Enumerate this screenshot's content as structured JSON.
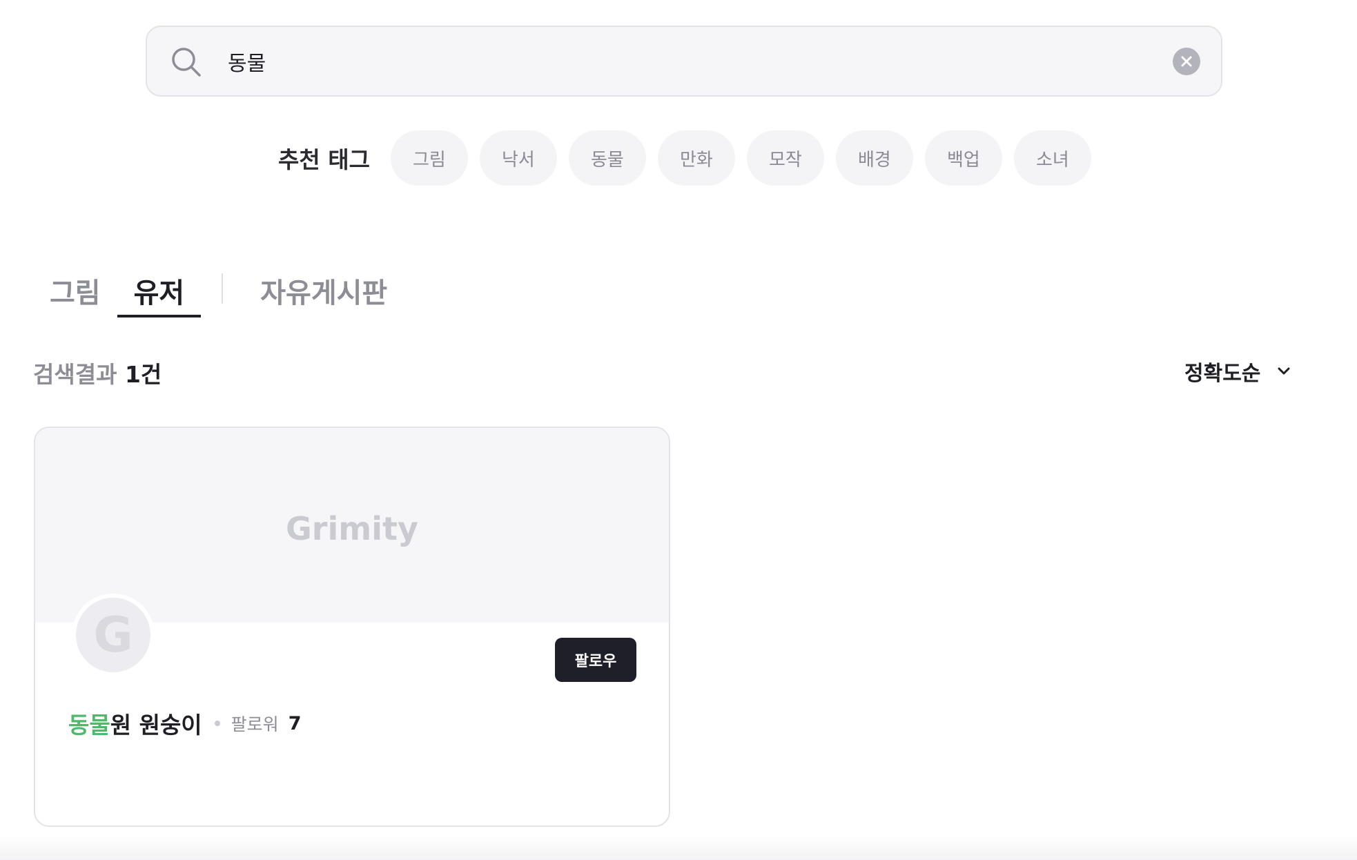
{
  "search": {
    "value": "동물",
    "icon": "search-icon",
    "clear_icon": "close-icon"
  },
  "recommended_tags": {
    "title": "추천 태그",
    "items": [
      "그림",
      "낙서",
      "동물",
      "만화",
      "모작",
      "배경",
      "백업",
      "소녀"
    ]
  },
  "tabs": [
    {
      "label": "그림",
      "active": false
    },
    {
      "label": "유저",
      "active": true
    },
    {
      "label": "자유게시판",
      "active": false
    }
  ],
  "results": {
    "prefix": "검색결과 ",
    "count": "1건"
  },
  "sort": {
    "selected": "정확도순",
    "icon": "chevron-down-icon"
  },
  "user_card": {
    "cover_logo": "Grimity",
    "avatar_letter": "G",
    "name_highlight": "동물",
    "name_rest": "원 원숭이",
    "follower_label": "팔로워",
    "follower_count": "7",
    "follow_button": "팔로우"
  },
  "colors": {
    "accent_highlight": "#4cba6a",
    "button_dark": "#1f1f29",
    "muted_text": "#8d8d96",
    "surface": "#f6f6f9"
  }
}
